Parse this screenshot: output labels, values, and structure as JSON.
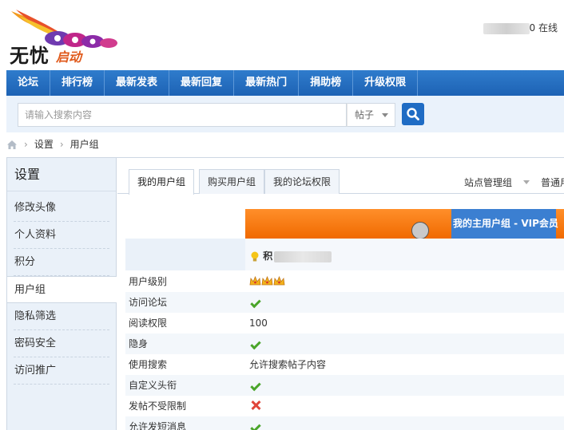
{
  "header": {
    "logo_text": "无忧",
    "logo_sub": "启动",
    "online_suffix": "在线",
    "online_digit": "0"
  },
  "nav": {
    "items": [
      "论坛",
      "排行榜",
      "最新发表",
      "最新回复",
      "最新热门",
      "捐助榜",
      "升级权限"
    ]
  },
  "search": {
    "placeholder": "请输入搜索内容",
    "type_label": "帖子"
  },
  "breadcrumb": {
    "items": [
      "设置",
      "用户组"
    ]
  },
  "sidebar": {
    "title": "设置",
    "items": [
      "修改头像",
      "个人资料",
      "积分",
      "用户组",
      "隐私筛选",
      "密码安全",
      "访问推广"
    ],
    "active_index": 3
  },
  "tabs": {
    "items": [
      "我的用户组",
      "购买用户组",
      "我的论坛权限"
    ],
    "active_index": 0,
    "right_dropdown": "站点管理组",
    "right_item": "普通用"
  },
  "group_table": {
    "banner_label": "我的主用户组 - VIP会员",
    "credit_label": "积",
    "rows": [
      {
        "label": "用户级别",
        "value_type": "crowns",
        "value": 3
      },
      {
        "label": "访问论坛",
        "value_type": "check"
      },
      {
        "label": "阅读权限",
        "value_type": "text",
        "value": "100"
      },
      {
        "label": "隐身",
        "value_type": "check"
      },
      {
        "label": "使用搜索",
        "value_type": "text",
        "value": "允许搜索帖子内容"
      },
      {
        "label": "自定义头衔",
        "value_type": "check"
      },
      {
        "label": "发帖不受限制",
        "value_type": "cross"
      },
      {
        "label": "允许发短消息",
        "value_type": "check"
      }
    ]
  },
  "colors": {
    "nav_bg": "#2a74c5",
    "banner_orange": "#f57a10",
    "banner_blue": "#3b7fd1",
    "check_green": "#4aa52a",
    "cross_red": "#e0453a"
  }
}
